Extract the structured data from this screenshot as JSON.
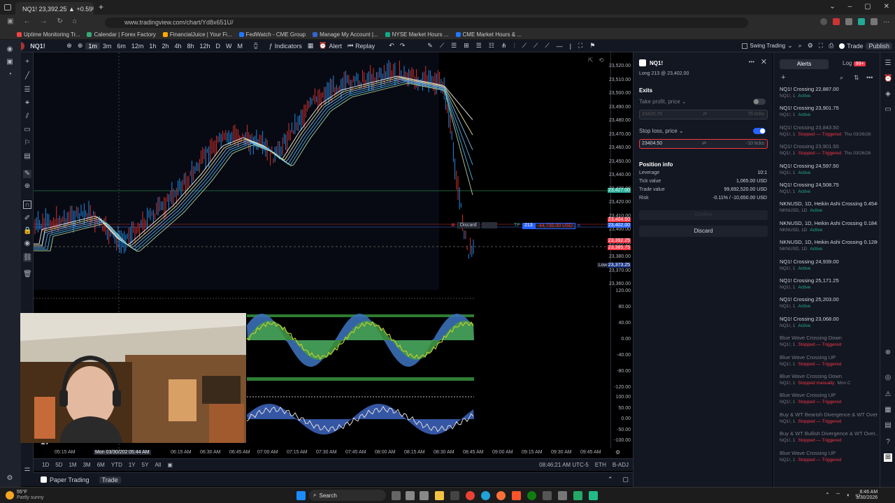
{
  "browser": {
    "tab_title": "NQ1! 23,392.25 ▲ +0.59% Swi",
    "url": "www.tradingview.com/chart/Yd8x651U/",
    "bookmarks": [
      "Uptime Monitoring Tr...",
      "Calendar | Forex Factory",
      "FinancialJuice | Your Fi...",
      "FedWatch - CME Group",
      "Manage My Account |...",
      "NYSE Market Hours ...",
      "CME Market Hours & ..."
    ]
  },
  "toolbar": {
    "symbol": "NQ1!",
    "intervals": [
      "1m",
      "3m",
      "6m",
      "12m",
      "1h",
      "2h",
      "4h",
      "8h",
      "12h",
      "D",
      "W",
      "M"
    ],
    "indicators_label": "Indicators",
    "alert_label": "Alert",
    "replay_label": "Replay",
    "layout_name": "Swing Trading",
    "trade_label": "Trade",
    "publish_label": "Publish"
  },
  "price_axis": {
    "labels": [
      "23,520.00",
      "23,510.00",
      "23,500.00",
      "23,490.00",
      "23,480.00",
      "23,470.00",
      "23,460.00",
      "23,450.00",
      "23,440.00",
      "23,430.00",
      "23,420.00",
      "23,410.00",
      "23,400.00",
      "23,390.00",
      "23,380.00",
      "23,370.00",
      "23,360.00"
    ],
    "tags": {
      "green": "23,427.00",
      "red_top": "23,404.50",
      "blue": "23,402.00",
      "red_mid": "23,392.25",
      "red_low": "23,385.75",
      "low_label": "Low",
      "low_value": "23,373.25"
    },
    "osc1": [
      "120.00",
      "80.00",
      "40.00",
      "0.00",
      "-40.00",
      "-80.00",
      "-120.00"
    ],
    "osc2": [
      "100.00",
      "50.00",
      "0.00",
      "-50.00",
      "-100.00"
    ]
  },
  "order_line": {
    "discard_label": "Discard",
    "tp_label": "TP",
    "qty": "213",
    "pnl": "-44,730.00 USD"
  },
  "time_axis": {
    "labels": [
      "05:15 AM",
      "Mon 03/30/2026",
      "05:44 AM",
      "06:15 AM",
      "06:30 AM",
      "06:45 AM",
      "07:00 AM",
      "07:15 AM",
      "07:30 AM",
      "07:45 AM",
      "08:00 AM",
      "08:15 AM",
      "08:30 AM",
      "08:45 AM",
      "09:00 AM",
      "09:15 AM",
      "09:30 AM",
      "09:45 AM"
    ]
  },
  "bottom_bar": {
    "ranges": [
      "1D",
      "5D",
      "1M",
      "3M",
      "6M",
      "YTD",
      "1Y",
      "5Y",
      "All"
    ],
    "clock": "08:46:21 AM UTC-5",
    "session": "ETH",
    "adj": "B-ADJ"
  },
  "footer": {
    "paper_trading": "Paper Trading",
    "trade": "Trade"
  },
  "order_panel": {
    "symbol": "NQ1!",
    "position_line": "Long 213 @ 23,402.00",
    "exits_title": "Exits",
    "take_profit_label": "Take profit, price",
    "take_profit_value": "23420.75",
    "take_profit_ticks": "75 ticks",
    "stop_loss_label": "Stop loss, price",
    "stop_loss_value": "23404.50",
    "stop_loss_ticks": "-10 ticks",
    "position_info_title": "Position info",
    "leverage_label": "Leverage",
    "leverage_value": "10:1",
    "tick_value_label": "Tick value",
    "tick_value": "1,065.00 USD",
    "trade_value_label": "Trade value",
    "trade_value": "99,692,520.00 USD",
    "risk_label": "Risk",
    "risk_value": "-0.11% / -10,650.00 USD",
    "confirm_label": "Confirm",
    "discard_label": "Discard"
  },
  "alerts_panel": {
    "tab_alerts": "Alerts",
    "tab_log": "Log",
    "log_badge": "99+",
    "items": [
      {
        "name": "NQ1! Crossing 22,887.00",
        "sub": "NQ1!, 1",
        "status": "Active",
        "extra": "",
        "dim": false
      },
      {
        "name": "NQ1! Crossing 23,901.75",
        "sub": "NQ1!, 1",
        "status": "Active",
        "extra": "",
        "dim": false
      },
      {
        "name": "NQ1! Crossing 23,843.50",
        "sub": "NQ1!, 1",
        "status": "Stopped — Triggered",
        "extra": "Thu 03/26/26",
        "dim": true
      },
      {
        "name": "NQ1! Crossing 23,901.50",
        "sub": "NQ1!, 1",
        "status": "Stopped — Triggered",
        "extra": "Thu 03/26/26",
        "dim": true
      },
      {
        "name": "NQ1! Crossing 24,597.50",
        "sub": "NQ1!, 1",
        "status": "Active",
        "extra": "",
        "dim": false
      },
      {
        "name": "NQ1! Crossing 24,508.75",
        "sub": "NQ1!, 1",
        "status": "Active",
        "extra": "",
        "dim": false
      },
      {
        "name": "NKNUSD, 1D, Heikin Ashi Crossing 0.4546",
        "sub": "NKNUSD, 1D",
        "status": "Active",
        "extra": "",
        "dim": false
      },
      {
        "name": "NKNUSD, 1D, Heikin Ashi Crossing 0.1842",
        "sub": "NKNUSD, 1D",
        "status": "Active",
        "extra": "",
        "dim": false
      },
      {
        "name": "NKNUSD, 1D, Heikin Ashi Crossing 0.1280",
        "sub": "NKNUSD, 1D",
        "status": "Active",
        "extra": "",
        "dim": false
      },
      {
        "name": "NQ1! Crossing 24,939.00",
        "sub": "NQ1!, 1",
        "status": "Active",
        "extra": "",
        "dim": false
      },
      {
        "name": "NQ1! Crossing 25,171.25",
        "sub": "NQ1!, 1",
        "status": "Active",
        "extra": "",
        "dim": false
      },
      {
        "name": "NQ1! Crossing 25,203.00",
        "sub": "NQ1!, 1",
        "status": "Active",
        "extra": "",
        "dim": false
      },
      {
        "name": "NQ1! Crossing 23,068.00",
        "sub": "NQ1!, 1",
        "status": "Active",
        "extra": "",
        "dim": false
      },
      {
        "name": "Blue Wave Crossing Down",
        "sub": "NQ1!, 1",
        "status": "Stopped — Triggered",
        "extra": "",
        "dim": true
      },
      {
        "name": "Blue Wave Crossing UP",
        "sub": "NQ1!, 1",
        "status": "Stopped — Triggered",
        "extra": "",
        "dim": true
      },
      {
        "name": "Blue Wave Crossing Down",
        "sub": "NQ1!, 1",
        "status": "Stopped manually",
        "extra": "Mon C",
        "dim": true
      },
      {
        "name": "Blue Wave Crossing UP",
        "sub": "NQ1!, 1",
        "status": "Stopped — Triggered",
        "extra": "",
        "dim": true
      },
      {
        "name": "Buy & WT Bearish Divergence & WT Over...",
        "sub": "NQ1!, 1",
        "status": "Stopped — Triggered",
        "extra": "",
        "dim": true
      },
      {
        "name": "Buy & WT Bullish Divergence & WT Over...",
        "sub": "NQ1!, 1",
        "status": "Stopped — Triggered",
        "extra": "",
        "dim": true
      },
      {
        "name": "Blue Wave Crossing UP",
        "sub": "NQ1!, 1",
        "status": "Stopped — Triggered",
        "extra": "",
        "dim": true
      }
    ]
  },
  "taskbar": {
    "weather_temp": "55°F",
    "weather_desc": "Partly sunny",
    "search_label": "Search",
    "time": "8:46 AM",
    "date": "3/30/2026"
  },
  "colors": {
    "bg": "#000000",
    "panel": "#131722",
    "border": "#2a2e39",
    "up": "#22ab94",
    "down": "#f23645",
    "accent": "#2962ff"
  }
}
